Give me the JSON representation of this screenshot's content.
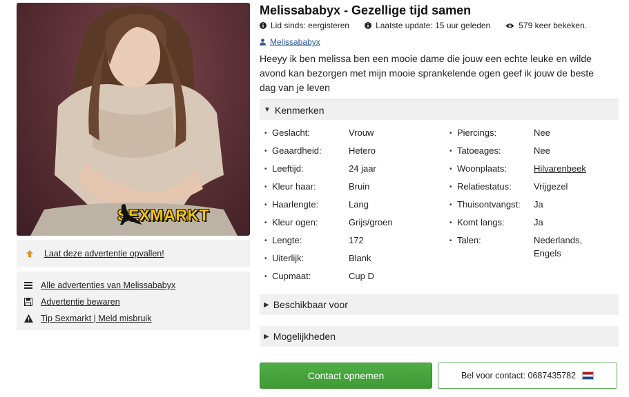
{
  "colors": {
    "link_blue": "#2a5a9a",
    "contact_green": "#43a23a",
    "boost_orange": "#f08a24",
    "section_bg": "#f0f0f0",
    "watermark_yellow": "#f5c400"
  },
  "photo": {
    "watermark": "SEXMARKT",
    "watermark_icon": "silhouette-figure-icon"
  },
  "sidebar": {
    "boost": {
      "icon": "arrow-up-icon",
      "label": "Laat deze advertentie opvallen!"
    },
    "links": [
      {
        "icon": "list-icon",
        "label": "Alle advertenties van Melissababyx"
      },
      {
        "icon": "save-icon",
        "label": "Advertentie bewaren"
      },
      {
        "icon": "warning-icon",
        "label": "Tip Sexmarkt | Meld misbruik"
      }
    ]
  },
  "ad": {
    "title": "Melissababyx - Gezellige tijd samen",
    "meta": {
      "member_since": "Lid sinds: eergisteren",
      "last_update": "Laatste update: 15 uur geleden",
      "views": "579 keer bekeken."
    },
    "username": "Melissababyx",
    "description": "Heeyy ik ben melissa ben een mooie dame die jouw een echte leuke en wilde avond kan bezorgen met mijn mooie sprankelende ogen geef ik jouw de beste dag van je leven"
  },
  "sections": {
    "kenmerken": "Kenmerken",
    "beschikbaar": "Beschikbaar voor",
    "mogelijkheden": "Mogelijkheden"
  },
  "properties_left": [
    {
      "key": "Geslacht:",
      "value": "Vrouw"
    },
    {
      "key": "Geaardheid:",
      "value": "Hetero"
    },
    {
      "key": "Leeftijd:",
      "value": "24 jaar"
    },
    {
      "key": "Kleur haar:",
      "value": "Bruin"
    },
    {
      "key": "Haarlengte:",
      "value": "Lang"
    },
    {
      "key": "Kleur ogen:",
      "value": "Grijs/groen"
    },
    {
      "key": "Lengte:",
      "value": "172"
    },
    {
      "key": "Uiterlijk:",
      "value": "Blank"
    },
    {
      "key": "Cupmaat:",
      "value": "Cup D"
    }
  ],
  "properties_right": [
    {
      "key": "Piercings:",
      "value": "Nee"
    },
    {
      "key": "Tatoeages:",
      "value": "Nee"
    },
    {
      "key": "Woonplaats:",
      "value": "Hilvarenbeek"
    },
    {
      "key": "Relatiestatus:",
      "value": "Vrijgezel"
    },
    {
      "key": "Thuisontvangst:",
      "value": "Ja"
    },
    {
      "key": "Komt langs:",
      "value": "Ja"
    },
    {
      "key": "Talen:",
      "value": "Nederlands, Engels"
    }
  ],
  "buttons": {
    "contact": "Contact opnemen",
    "call": "Bel voor contact: 0687435782",
    "call_flag": "netherlands-flag-icon"
  }
}
